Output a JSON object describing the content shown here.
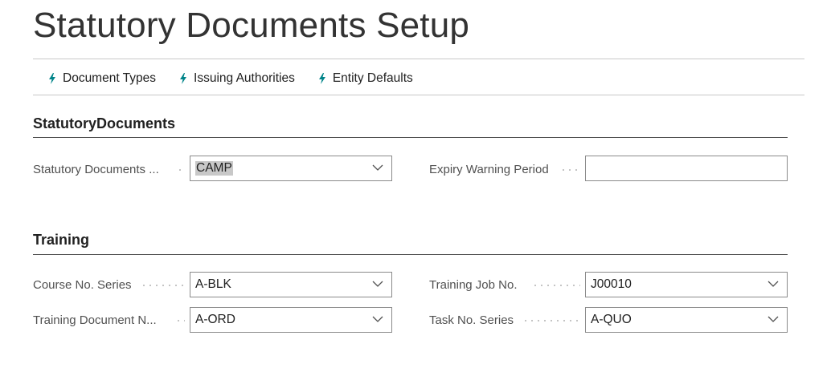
{
  "page": {
    "title": "Statutory Documents Setup"
  },
  "actions": [
    {
      "label": "Document Types",
      "icon": "lightning-icon"
    },
    {
      "label": "Issuing Authorities",
      "icon": "lightning-icon"
    },
    {
      "label": "Entity Defaults",
      "icon": "lightning-icon"
    }
  ],
  "groups": {
    "statutory": {
      "title": "StatutoryDocuments",
      "fields": {
        "nos": {
          "label": "Statutory Documents ...",
          "value": "CAMP"
        },
        "expiry": {
          "label": "Expiry Warning Period",
          "value": ""
        }
      }
    },
    "training": {
      "title": "Training",
      "fields": {
        "course": {
          "label": "Course No. Series",
          "value": "A-BLK"
        },
        "doc": {
          "label": "Training Document N...",
          "value": "A-ORD"
        },
        "job": {
          "label": "Training Job No.",
          "value": "J00010"
        },
        "task": {
          "label": "Task No. Series",
          "value": "A-QUO"
        }
      }
    }
  },
  "colors": {
    "accent": "#008489",
    "text": "#212121",
    "label": "#505050"
  }
}
